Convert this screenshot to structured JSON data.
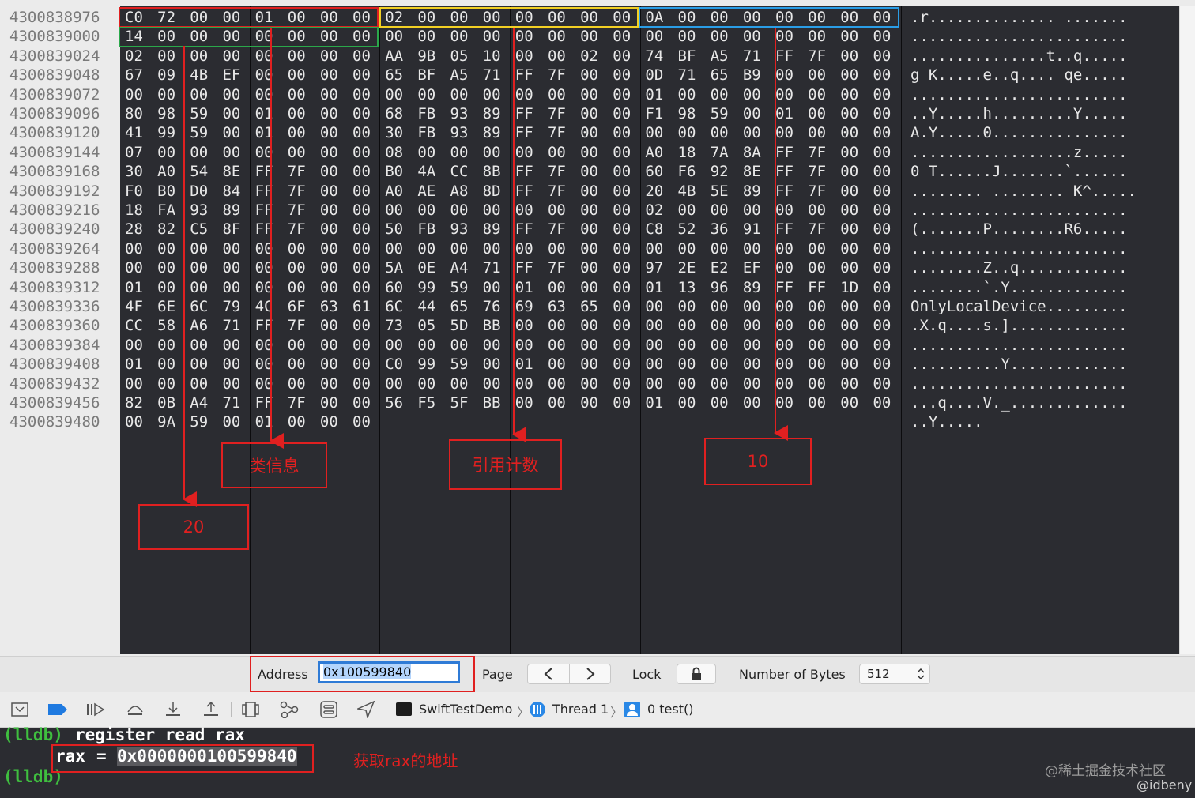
{
  "memory": {
    "rows": [
      {
        "addr": "4300838976",
        "hex": "C0 72 00 00 01 00 00 00 02 00 00 00 00 00 00 00 0A 00 00 00 00 00 00 00",
        "ascii": ".r.............. ......."
      },
      {
        "addr": "4300839000",
        "hex": "14 00 00 00 00 00 00 00 00 00 00 00 00 00 00 00 00 00 00 00 00 00 00 00",
        "ascii": "........................"
      },
      {
        "addr": "4300839024",
        "hex": "02 00 00 00 00 00 00 00 AA 9B 05 10 00 00 02 00 74 BF A5 71 FF 7F 00 00",
        "ascii": "...............t..q....."
      },
      {
        "addr": "4300839048",
        "hex": "67 09 4B EF 00 00 00 00 65 BF A5 71 FF 7F 00 00 0D 71 65 B9 00 00 00 00",
        "ascii": "g K.....e..q.... qe....."
      },
      {
        "addr": "4300839072",
        "hex": "00 00 00 00 00 00 00 00 00 00 00 00 00 00 00 00 01 00 00 00 00 00 00 00",
        "ascii": "........................"
      },
      {
        "addr": "4300839096",
        "hex": "80 98 59 00 01 00 00 00 68 FB 93 89 FF 7F 00 00 F1 98 59 00 01 00 00 00",
        "ascii": "..Y.....h.........Y....."
      },
      {
        "addr": "4300839120",
        "hex": "41 99 59 00 01 00 00 00 30 FB 93 89 FF 7F 00 00 00 00 00 00 00 00 00 00",
        "ascii": "A.Y.....0..............."
      },
      {
        "addr": "4300839144",
        "hex": "07 00 00 00 00 00 00 00 08 00 00 00 00 00 00 00 A0 18 7A 8A FF 7F 00 00",
        "ascii": "..................z....."
      },
      {
        "addr": "4300839168",
        "hex": "30 A0 54 8E FF 7F 00 00 B0 4A CC 8B FF 7F 00 00 60 F6 92 8E FF 7F 00 00",
        "ascii": "0 T......J.......`......"
      },
      {
        "addr": "4300839192",
        "hex": "F0 B0 D0 84 FF 7F 00 00 A0 AE A8 8D FF 7F 00 00 20 4B 5E 89 FF 7F 00 00",
        "ascii": "........ ........ K^....."
      },
      {
        "addr": "4300839216",
        "hex": "18 FA 93 89 FF 7F 00 00 00 00 00 00 00 00 00 00 02 00 00 00 00 00 00 00",
        "ascii": "........................"
      },
      {
        "addr": "4300839240",
        "hex": "28 82 C5 8F FF 7F 00 00 50 FB 93 89 FF 7F 00 00 C8 52 36 91 FF 7F 00 00",
        "ascii": "(.......P........R6....."
      },
      {
        "addr": "4300839264",
        "hex": "00 00 00 00 00 00 00 00 00 00 00 00 00 00 00 00 00 00 00 00 00 00 00 00",
        "ascii": "........................"
      },
      {
        "addr": "4300839288",
        "hex": "00 00 00 00 00 00 00 00 5A 0E A4 71 FF 7F 00 00 97 2E E2 EF 00 00 00 00",
        "ascii": "........Z..q............"
      },
      {
        "addr": "4300839312",
        "hex": "01 00 00 00 00 00 00 00 60 99 59 00 01 00 00 00 01 13 96 89 FF FF 1D 00",
        "ascii": "........`.Y............."
      },
      {
        "addr": "4300839336",
        "hex": "4F 6E 6C 79 4C 6F 63 61 6C 44 65 76 69 63 65 00 00 00 00 00 00 00 00 00",
        "ascii": "OnlyLocalDevice........."
      },
      {
        "addr": "4300839360",
        "hex": "CC 58 A6 71 FF 7F 00 00 73 05 5D BB 00 00 00 00 00 00 00 00 00 00 00 00",
        "ascii": ".X.q....s.]............."
      },
      {
        "addr": "4300839384",
        "hex": "00 00 00 00 00 00 00 00 00 00 00 00 00 00 00 00 00 00 00 00 00 00 00 00",
        "ascii": "........................"
      },
      {
        "addr": "4300839408",
        "hex": "01 00 00 00 00 00 00 00 C0 99 59 00 01 00 00 00 00 00 00 00 00 00 00 00",
        "ascii": "..........Y............."
      },
      {
        "addr": "4300839432",
        "hex": "00 00 00 00 00 00 00 00 00 00 00 00 00 00 00 00 00 00 00 00 00 00 00 00",
        "ascii": "........................"
      },
      {
        "addr": "4300839456",
        "hex": "82 0B A4 71 FF 7F 00 00 56 F5 5F BB 00 00 00 00 01 00 00 00 00 00 00 00",
        "ascii": "...q....V._............."
      },
      {
        "addr": "4300839480",
        "hex": "00 9A 59 00 01 00 00 00",
        "ascii": "..Y....."
      }
    ]
  },
  "annotations": {
    "class_info": "类信息",
    "ref_count": "引用计数",
    "value_20": "20",
    "value_10": "10",
    "get_rax": "获取rax的地址"
  },
  "toolbar": {
    "address_label": "Address",
    "address_value": "0x100599840",
    "page_label": "Page",
    "prev_icon": "chevron-left",
    "next_icon": "chevron-right",
    "lock_label": "Lock",
    "lock_icon": "lock",
    "bytes_label": "Number of Bytes",
    "bytes_value": "512"
  },
  "debugbar": {
    "project": "SwiftTestDemo",
    "thread": "Thread 1",
    "frame": "0 test()"
  },
  "console": {
    "prompt": "(lldb)",
    "command": "register read rax",
    "reg_name": "rax",
    "eq": "=",
    "reg_value": "0x0000000100599840",
    "prompt2": "(lldb)"
  },
  "watermark": {
    "site": "@稀土掘金技术社区",
    "user": "@idbeny"
  },
  "colors": {
    "annotation_red": "#e02020",
    "highlight_yellow": "#f2d024",
    "highlight_blue": "#2a9de6",
    "highlight_green": "#2aa84a",
    "lldb_green": "#3fbf3f",
    "selection_blue": "#2f7bd6"
  }
}
